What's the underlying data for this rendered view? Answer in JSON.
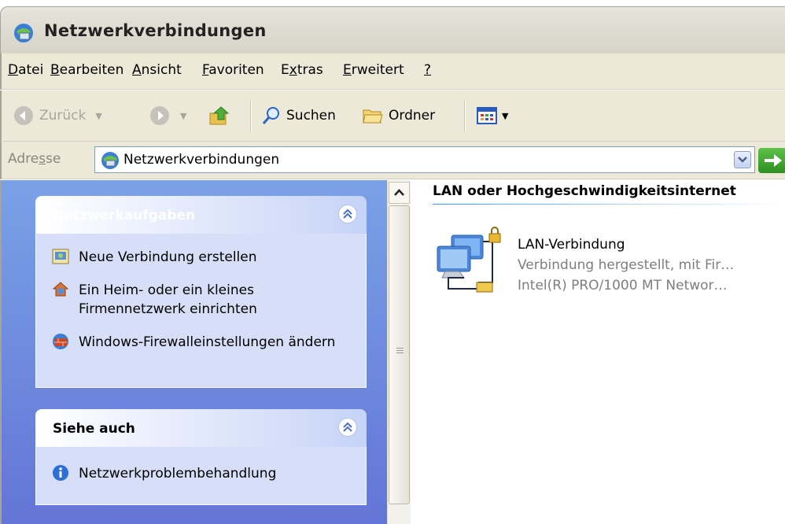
{
  "window": {
    "title": "Netzwerkverbindungen"
  },
  "menu": [
    {
      "pre": "",
      "u": "D",
      "post": "atei"
    },
    {
      "pre": "",
      "u": "B",
      "post": "earbeiten"
    },
    {
      "pre": "",
      "u": "A",
      "post": "nsicht"
    },
    {
      "pre": "",
      "u": "F",
      "post": "avoriten"
    },
    {
      "pre": "E",
      "u": "x",
      "post": "tras"
    },
    {
      "pre": "",
      "u": "E",
      "post": "rweitert"
    },
    {
      "pre": "",
      "u": "?",
      "post": ""
    }
  ],
  "toolbar": {
    "back": "Zurück",
    "search": "Suchen",
    "folders": "Ordner"
  },
  "address": {
    "label_pre": "Adre",
    "label_u": "s",
    "label_post": "se",
    "value": "Netzwerkverbindungen"
  },
  "tasks_panel": {
    "title": "Netzwerkaufgaben",
    "items": [
      {
        "icon": "new-connection-icon",
        "label": "Neue Verbindung erstellen"
      },
      {
        "icon": "home-network-icon",
        "label": "Ein Heim- oder ein kleines Firmennetzwerk einrichten"
      },
      {
        "icon": "firewall-icon",
        "label": "Windows-Firewalleinstellungen ändern"
      }
    ]
  },
  "see_also_panel": {
    "title": "Siehe auch",
    "items": [
      {
        "icon": "info-icon",
        "label": "Netzwerkproblembehandlung"
      }
    ]
  },
  "content": {
    "group_title": "LAN oder Hochgeschwindigkeitsinternet",
    "connection": {
      "name": "LAN-Verbindung",
      "status": "Verbindung hergestellt, mit Fir…",
      "device": "Intel(R) PRO/1000 MT Networ…"
    }
  },
  "colors": {
    "task_pane_gradient_top": "#7aa1e6",
    "task_pane_gradient_bottom": "#6375d6",
    "panel_bg": "#d6dff7",
    "heading_blue": "#215dc6"
  }
}
